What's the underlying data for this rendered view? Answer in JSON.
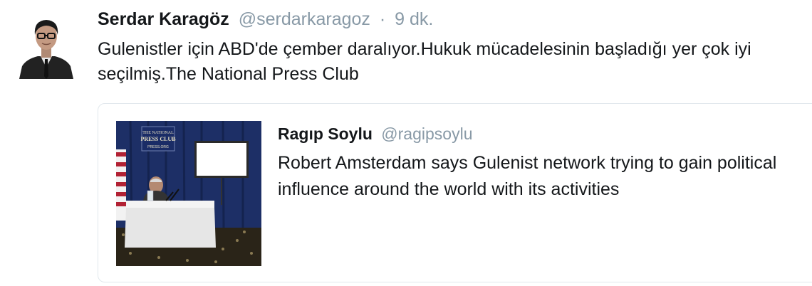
{
  "tweet": {
    "author_name": "Serdar Karagöz",
    "author_handle": "@serdarkaragoz",
    "separator": "·",
    "timestamp": "9 dk.",
    "text": "Gulenistler için ABD'de çember daralıyor.Hukuk mücadelesinin başladığı yer çok iyi seçilmiş.The National Press Club"
  },
  "quoted_tweet": {
    "author_name": "Ragıp Soylu",
    "author_handle": "@ragipsoylu",
    "text": "Robert Amsterdam says Gulenist network trying to gain political influence around the world with its activities",
    "media_sign_lines": [
      "THE NATIONAL",
      "PRESS CLUB",
      "PRESS.ORG"
    ]
  },
  "colors": {
    "text_primary": "#14171a",
    "text_secondary": "#8899a6",
    "card_border": "#e1e8ed"
  }
}
